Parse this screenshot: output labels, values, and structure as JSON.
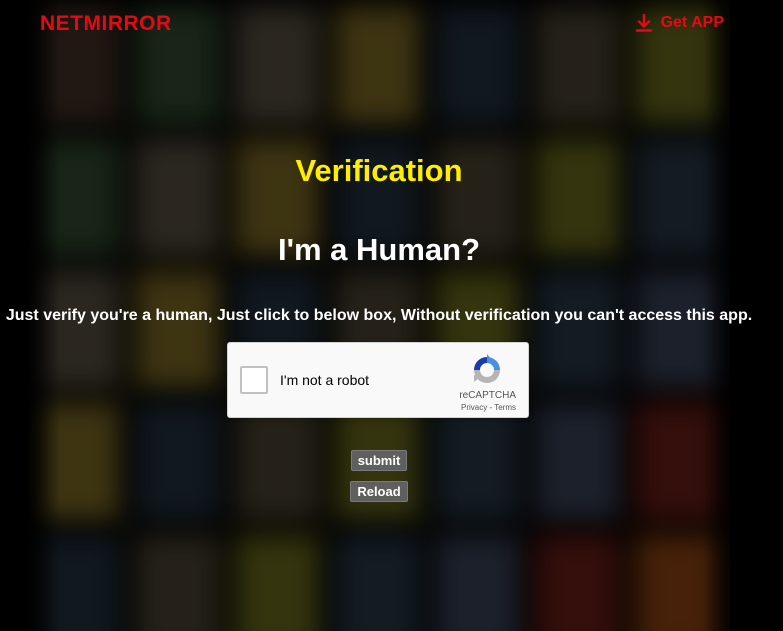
{
  "header": {
    "logo_text": "NETMIRROR",
    "get_app_label": "Get APP",
    "get_app_icon": "download-icon"
  },
  "main": {
    "title": "Verification",
    "subtitle": "I'm a Human?",
    "message": "Just verify you're a human, Just click to below box, Without verification you can't access this app."
  },
  "captcha": {
    "label": "I'm not a robot",
    "brand": "reCAPTCHA",
    "privacy_link": "Privacy",
    "link_separator": " - ",
    "terms_link": "Terms",
    "checked": false,
    "logo_icon": "recaptcha-icon"
  },
  "buttons": {
    "submit_label": "submit",
    "reload_label": "Reload"
  },
  "colors": {
    "brand_red": "#e50914",
    "title_yellow": "#ffee00",
    "button_gray": "#5f5f5f"
  }
}
